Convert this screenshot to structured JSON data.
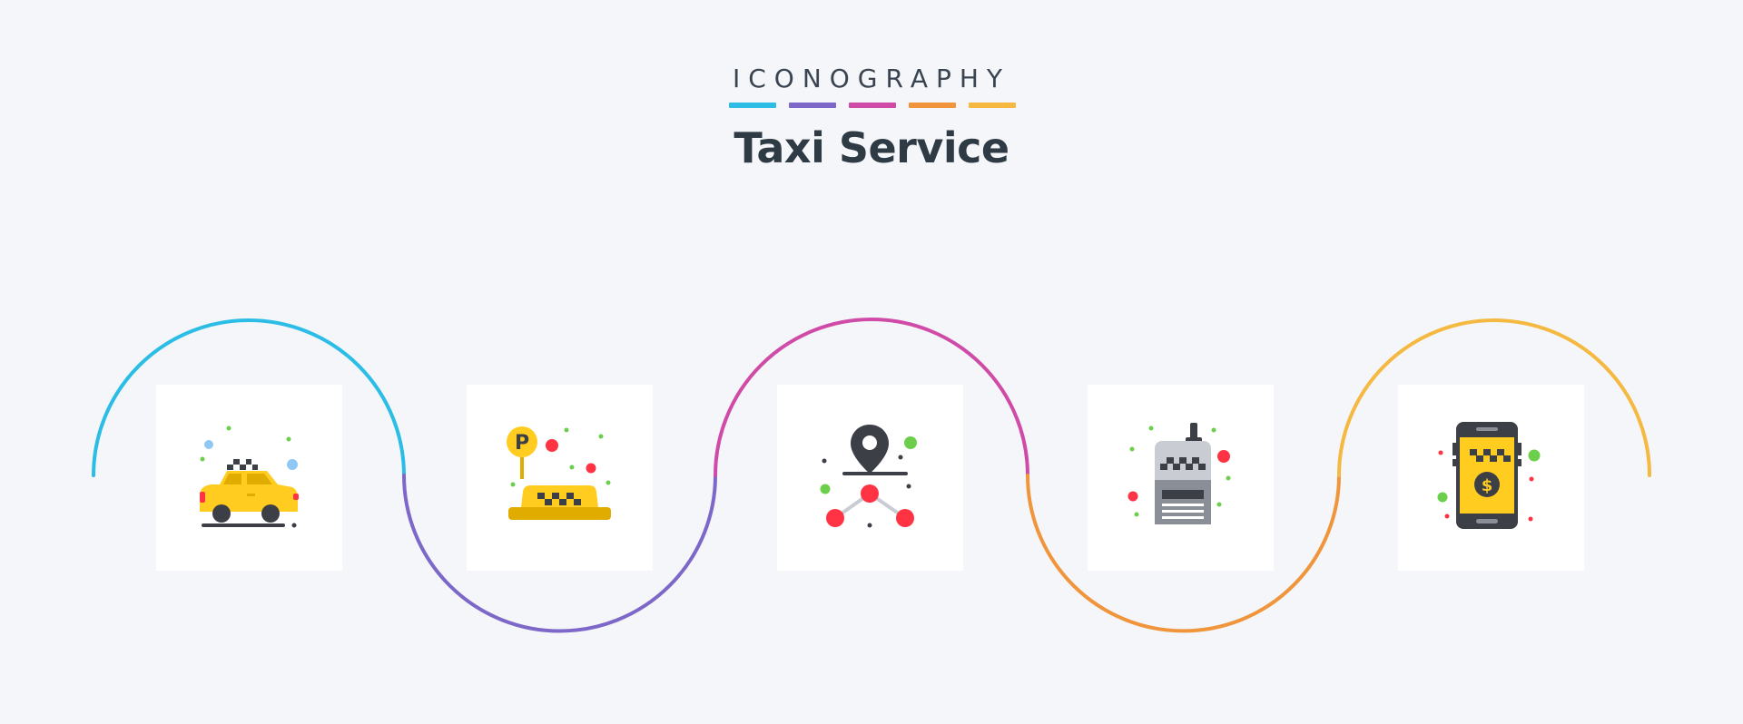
{
  "header": {
    "brand": "ICONOGRAPHY",
    "title": "Taxi Service",
    "accent_bars": [
      "#2bbde6",
      "#7d68c9",
      "#cf4ba7",
      "#f0953c",
      "#f5b942"
    ]
  },
  "wave_colors": [
    "#2bbde6",
    "#7d68c9",
    "#cf4ba7",
    "#f0953c",
    "#f5b942"
  ],
  "icons": [
    {
      "name": "taxi-car-icon"
    },
    {
      "name": "taxi-parking-sign-icon"
    },
    {
      "name": "location-network-icon"
    },
    {
      "name": "taxi-radio-walkie-talkie-icon"
    },
    {
      "name": "mobile-taxi-payment-icon"
    }
  ],
  "colors": {
    "taxi_yellow": "#ffcc1f",
    "taxi_dark_yellow": "#e0ac00",
    "dark": "#3c3f46",
    "red": "#ff3344",
    "green": "#6ccf4b",
    "blue": "#8fc8f5",
    "grey": "#c9ccd3",
    "dark_grey": "#8a8e97"
  }
}
